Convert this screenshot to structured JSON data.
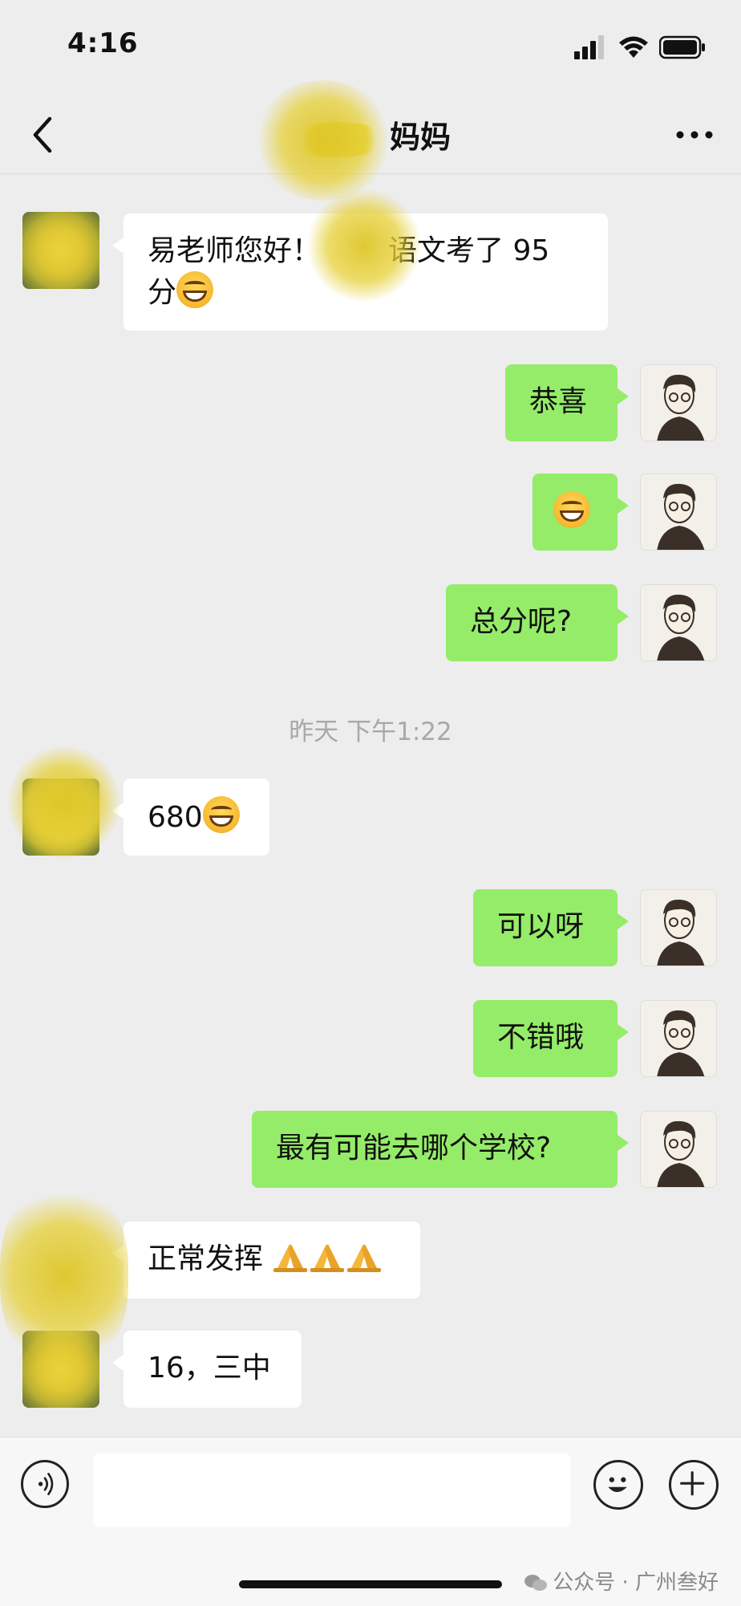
{
  "status_bar": {
    "time": "4:16"
  },
  "nav": {
    "title_visible": "妈妈"
  },
  "messages": [
    {
      "side": "in",
      "text": "易老师您好！",
      "text_after_blur": "语文考了 95",
      "line2": "分",
      "emoji": "grin"
    },
    {
      "side": "out",
      "text": "恭喜"
    },
    {
      "side": "out",
      "text": "",
      "emoji": "grin"
    },
    {
      "side": "out",
      "text": "总分呢?"
    },
    {
      "side": "in",
      "text": "680",
      "emoji": "grin"
    },
    {
      "side": "out",
      "text": "可以呀"
    },
    {
      "side": "out",
      "text": "不错哦"
    },
    {
      "side": "out",
      "text": "最有可能去哪个学校?"
    },
    {
      "side": "in",
      "text": "正常发挥",
      "emoji": "pray-x3"
    },
    {
      "side": "in",
      "text": "16，三中"
    }
  ],
  "timestamp": "昨天 下午1:22",
  "input": {
    "value": ""
  },
  "watermark": "公众号 · 广州叁好",
  "icons": {
    "back": "chevron-left-icon",
    "more": "more-dots-icon",
    "voice": "voice-icon",
    "emoji": "emoji-icon",
    "plus": "plus-icon"
  },
  "colors": {
    "outgoing_bubble": "#95ec69",
    "incoming_bubble": "#ffffff",
    "background": "#ededed"
  }
}
